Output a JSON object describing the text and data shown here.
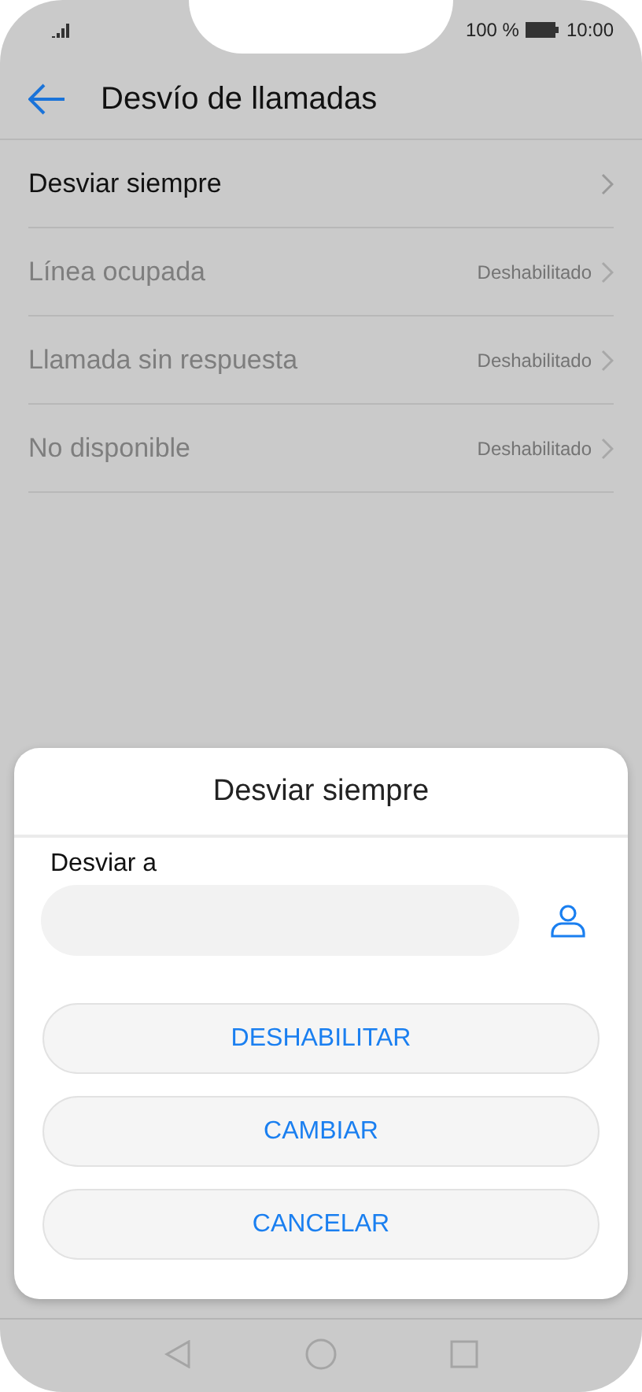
{
  "status_bar": {
    "battery": "100 %",
    "time": "10:00"
  },
  "header": {
    "title": "Desvío de llamadas"
  },
  "items": [
    {
      "label": "Desviar siempre",
      "disabled": false
    },
    {
      "label": "Línea ocupada",
      "status": "Deshabilitado",
      "disabled": true
    },
    {
      "label": "Llamada sin respuesta",
      "status": "Deshabilitado",
      "disabled": true
    },
    {
      "label": "No disponible",
      "status": "Deshabilitado",
      "disabled": true
    }
  ],
  "dialog": {
    "title": "Desviar siempre",
    "field_label": "Desviar a",
    "buttons": [
      "DESHABILITAR",
      "CAMBIAR",
      "CANCELAR"
    ]
  }
}
